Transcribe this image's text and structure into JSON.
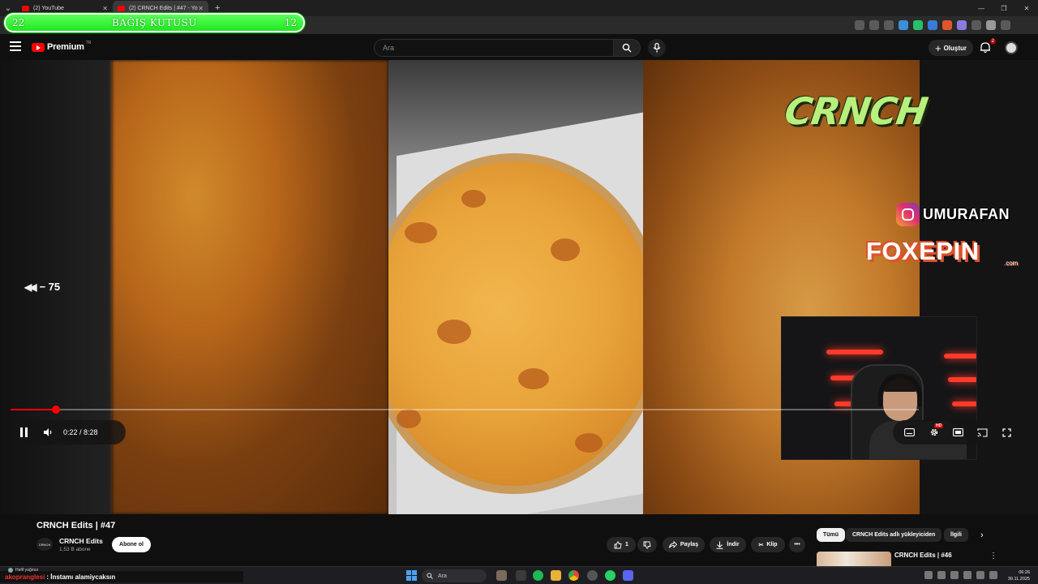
{
  "browser": {
    "tabs": [
      {
        "label": "(2) YouTube",
        "close": "✕"
      },
      {
        "label": "(2) CRNCH Edits | #47 - Yo",
        "close": "✕"
      }
    ],
    "new_tab": "+",
    "window_controls": [
      "—",
      "❐",
      "✕"
    ]
  },
  "overlay": {
    "donation_left": "22",
    "donation_title": "BAĞIŞ KUTUSU",
    "donation_right": "12",
    "brand": "CRNCH",
    "instagram_handle": "UMURAFAN",
    "sponsor": "FOXEPIN",
    "sponsor_suffix": ".com",
    "seek_hint": "− 75"
  },
  "header": {
    "logo_text": "Premium",
    "logo_region": "TR",
    "search_placeholder": "Ara",
    "create_label": "Oluştur",
    "notification_count": "2"
  },
  "player": {
    "current_time": "0:22",
    "duration": "8:28",
    "time_display": "0:22 / 8:28",
    "progress_fraction": 0.043,
    "volume_fraction": 0.58,
    "hd_badge": "HD"
  },
  "video": {
    "title": "CRNCH Edits | #47",
    "channel_name": "CRNCH Edits",
    "channel_avatar_text": "CRNCH",
    "subscribers": "1,53 B abone",
    "subscribe_label": "Abone ol",
    "like_count": "1",
    "share_label": "Paylaş",
    "download_label": "İndir",
    "clip_label": "Klip",
    "more_label": "•••"
  },
  "recommendations": {
    "chips": [
      "Tümü",
      "CRNCH Edits adlı yükleyiciden",
      "İlgili"
    ],
    "next_arrow": "›",
    "first_title": "CRNCH Edits | #46"
  },
  "chat": {
    "user": "akopranglesi",
    "message": ": İnstamı alamiycaksın",
    "weather": "Hafif yağmur"
  },
  "taskbar": {
    "search_label": "Ara",
    "time": "06:26",
    "date": "30.11.2025"
  },
  "colors": {
    "accent_red": "#ff0000",
    "donation_green": "#2ef52e",
    "brand_green": "#b7f07c"
  }
}
